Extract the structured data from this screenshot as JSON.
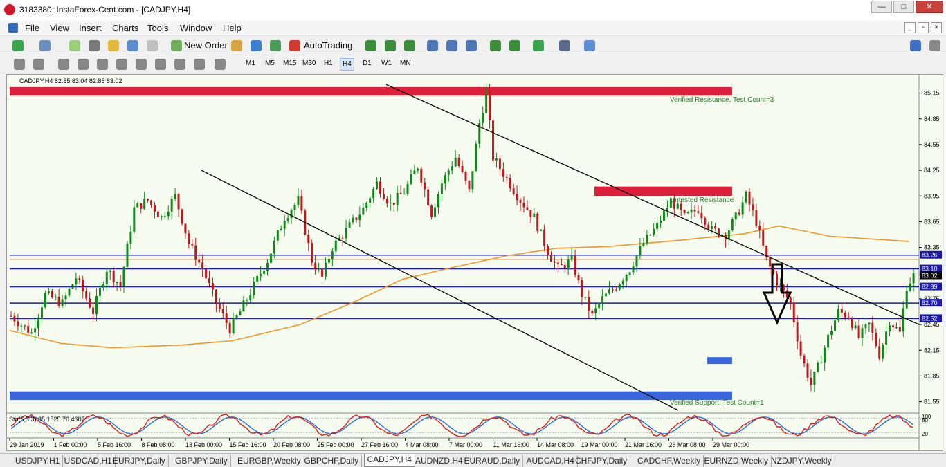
{
  "window": {
    "title": "3183380: InstaForex-Cent.com - [CADJPY,H4]"
  },
  "menu": [
    "File",
    "View",
    "Insert",
    "Charts",
    "Tools",
    "Window",
    "Help"
  ],
  "toolbar": {
    "new_order": "New Order",
    "autotrading": "AutoTrading"
  },
  "timeframes": [
    "M1",
    "M5",
    "M15",
    "M30",
    "H1",
    "H4",
    "D1",
    "W1",
    "MN"
  ],
  "active_timeframe": "H4",
  "chart_header": "CADJPY,H4  82.85 83.04 82.85 83.02",
  "oscillator_header": "Sto(5,3,3) 85.1525 76.4607",
  "osc_levels": [
    "100",
    "80",
    "20"
  ],
  "zone_labels": {
    "top": "Verified Resistance, Test Count=3",
    "mid": "Untested Resistance",
    "bottom": "Verified Support, Test Count=1"
  },
  "tabs": [
    "USDJPY,H1",
    "USDCAD,H1",
    "EURJPY,Daily",
    "GBPJPY,Daily",
    "EURGBP,Weekly",
    "GBPCHF,Daily",
    "CADJPY,H4",
    "AUDNZD,H4",
    "EURAUD,Daily",
    "AUDCAD,H4",
    "CHFJPY,Daily",
    "CADCHF,Weekly",
    "EURNZD,Weekly",
    "NZDJPY,Weekly"
  ],
  "active_tab": "CADJPY,H4",
  "colors": {
    "resistance": "#dc1f3a",
    "support": "#3966dc",
    "hline": "#1a1aa8",
    "bull": "#0e8a17",
    "bear": "#c0181c",
    "ma": "#f0962a",
    "stoch_main": "#e01818",
    "stoch_signal": "#2a6dd0"
  },
  "chart_data": {
    "type": "candlestick",
    "symbol": "CADJPY",
    "timeframe": "H4",
    "ohlc_last": {
      "open": 82.85,
      "high": 83.04,
      "low": 82.85,
      "close": 83.02
    },
    "ylim": [
      81.45,
      85.3
    ],
    "yticks": [
      "85.15",
      "84.85",
      "84.55",
      "84.25",
      "83.95",
      "83.65",
      "83.35",
      "83.05",
      "82.75",
      "82.45",
      "82.15",
      "81.85",
      "81.55"
    ],
    "xticks": [
      "29 Jan 2019",
      "1 Feb 00:00",
      "5 Feb 16:00",
      "8 Feb 08:00",
      "13 Feb 00:00",
      "15 Feb 16:00",
      "20 Feb 08:00",
      "25 Feb 00:00",
      "27 Feb 16:00",
      "4 Mar 08:00",
      "7 Mar 00:00",
      "11 Mar 16:00",
      "14 Mar 08:00",
      "19 Mar 00:00",
      "21 Mar 16:00",
      "26 Mar 08:00",
      "29 Mar 00:00"
    ],
    "hlines": [
      83.26,
      83.1,
      82.89,
      82.7,
      82.52
    ],
    "price_tags": [
      "83.26",
      "83.10",
      "83.02",
      "82.89",
      "82.70",
      "82.52"
    ],
    "price_path": [
      [
        0,
        82.55
      ],
      [
        6,
        82.35
      ],
      [
        10,
        82.8
      ],
      [
        15,
        82.7
      ],
      [
        19,
        83.0
      ],
      [
        24,
        82.6
      ],
      [
        28,
        83.1
      ],
      [
        32,
        82.9
      ],
      [
        36,
        83.8
      ],
      [
        40,
        83.9
      ],
      [
        44,
        83.7
      ],
      [
        48,
        83.95
      ],
      [
        52,
        83.4
      ],
      [
        56,
        83.1
      ],
      [
        60,
        82.7
      ],
      [
        64,
        82.4
      ],
      [
        67,
        82.6
      ],
      [
        71,
        82.9
      ],
      [
        75,
        83.2
      ],
      [
        80,
        83.7
      ],
      [
        84,
        83.9
      ],
      [
        88,
        83.2
      ],
      [
        91,
        83.0
      ],
      [
        94,
        83.35
      ],
      [
        98,
        83.55
      ],
      [
        103,
        83.8
      ],
      [
        107,
        84.1
      ],
      [
        111,
        83.85
      ],
      [
        115,
        84.0
      ],
      [
        119,
        84.3
      ],
      [
        123,
        83.75
      ],
      [
        126,
        84.1
      ],
      [
        130,
        84.4
      ],
      [
        134,
        84.0
      ],
      [
        137,
        84.8
      ],
      [
        139,
        85.15
      ],
      [
        141,
        84.4
      ],
      [
        145,
        84.15
      ],
      [
        149,
        83.9
      ],
      [
        153,
        83.7
      ],
      [
        157,
        83.3
      ],
      [
        160,
        83.1
      ],
      [
        164,
        83.2
      ],
      [
        167,
        82.8
      ],
      [
        170,
        82.55
      ],
      [
        173,
        82.75
      ],
      [
        177,
        82.9
      ],
      [
        181,
        83.1
      ],
      [
        185,
        83.4
      ],
      [
        189,
        83.6
      ],
      [
        193,
        83.9
      ],
      [
        197,
        83.7
      ],
      [
        201,
        83.8
      ],
      [
        205,
        83.55
      ],
      [
        209,
        83.5
      ],
      [
        212,
        83.7
      ],
      [
        215,
        83.95
      ],
      [
        218,
        83.65
      ],
      [
        221,
        83.2
      ],
      [
        224,
        82.95
      ],
      [
        228,
        82.7
      ],
      [
        231,
        82.1
      ],
      [
        234,
        81.75
      ],
      [
        236,
        81.95
      ],
      [
        239,
        82.3
      ],
      [
        242,
        82.6
      ],
      [
        245,
        82.55
      ],
      [
        248,
        82.3
      ],
      [
        251,
        82.45
      ],
      [
        254,
        82.1
      ],
      [
        257,
        82.5
      ],
      [
        260,
        82.35
      ],
      [
        262,
        82.9
      ],
      [
        264,
        83.02
      ]
    ],
    "ma_path": [
      [
        0,
        82.38
      ],
      [
        15,
        82.23
      ],
      [
        30,
        82.18
      ],
      [
        50,
        82.21
      ],
      [
        65,
        82.26
      ],
      [
        85,
        82.45
      ],
      [
        100,
        82.7
      ],
      [
        115,
        82.98
      ],
      [
        130,
        83.12
      ],
      [
        145,
        83.25
      ],
      [
        160,
        83.34
      ],
      [
        175,
        83.36
      ],
      [
        195,
        83.43
      ],
      [
        215,
        83.51
      ],
      [
        225,
        83.6
      ],
      [
        240,
        83.48
      ],
      [
        263,
        83.42
      ]
    ],
    "trendlines": [
      {
        "from": [
          "5 Feb 16:00",
          84.25
        ],
        "to": [
          "21 Mar 16:00",
          81.45
        ]
      },
      {
        "from": [
          "27 Feb 16:00",
          85.25
        ],
        "to": [
          "29 Mar 00:00+",
          82.45
        ]
      }
    ],
    "zones": [
      {
        "type": "resistance",
        "label": "Verified Resistance, Test Count=3",
        "top": 85.22,
        "bottom": 85.12
      },
      {
        "type": "resistance",
        "label": "Untested Resistance",
        "top": 84.06,
        "bottom": 83.95
      },
      {
        "type": "support",
        "label": "Verified Support, Test Count=1",
        "top": 81.67,
        "bottom": 81.57
      },
      {
        "type": "support",
        "label": "",
        "top": 82.07,
        "bottom": 81.99
      }
    ],
    "arrow": "down",
    "oscillator": {
      "name": "Sto(5,3,3)",
      "main": 85.1525,
      "signal": 76.4607,
      "levels": [
        100,
        80,
        20
      ]
    }
  }
}
